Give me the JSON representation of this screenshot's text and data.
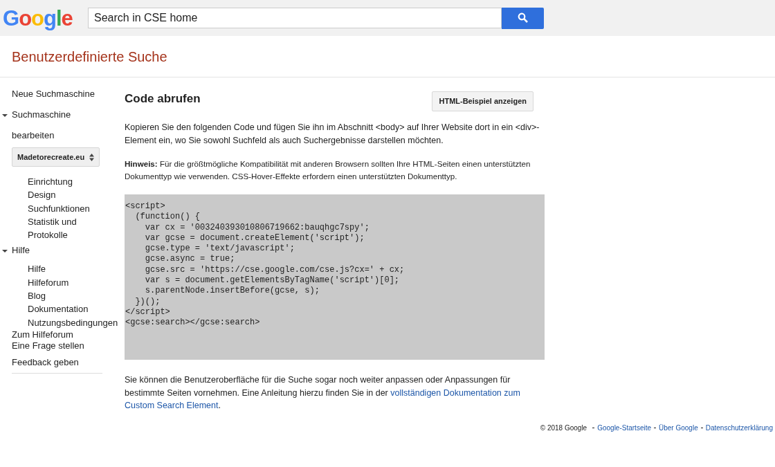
{
  "header": {
    "logo": "Google",
    "search": {
      "placeholder": "Search in CSE home"
    }
  },
  "page_title": "Benutzerdefinierte Suche",
  "sidebar": {
    "items": [
      {
        "kind": "link",
        "label": "Neue Suchmaschine"
      },
      {
        "kind": "section",
        "label": "Suchmaschine bearbeiten",
        "expanded": true,
        "select": "Madetorecreate.eu",
        "children": [
          {
            "label": "Einrichtung"
          },
          {
            "label": "Design"
          },
          {
            "label": "Suchfunktionen"
          },
          {
            "label": "Statistik und Protokolle"
          }
        ]
      },
      {
        "kind": "section",
        "label": "Hilfe",
        "expanded": true,
        "children": [
          {
            "label": "Hilfe"
          },
          {
            "label": "Hilfeforum"
          },
          {
            "label": "Blog"
          },
          {
            "label": "Dokumentation"
          },
          {
            "label": "Nutzungsbedingungen"
          }
        ]
      },
      {
        "kind": "link",
        "label": "Zum Hilfeforum"
      },
      {
        "kind": "link",
        "label": "Eine Frage stellen"
      },
      {
        "kind": "link",
        "label": "Feedback geben"
      }
    ]
  },
  "main": {
    "heading": "Code abrufen",
    "button": "HTML-Beispiel anzeigen",
    "intro": "Kopieren Sie den folgenden Code und fügen Sie ihn im Abschnitt <body> auf Ihrer Website dort in ein <div>-Element ein, wo Sie sowohl Suchfeld als auch Suchergebnisse darstellen möchten.",
    "note": "**Hinweis:** Für die größtmögliche Kompatibilität mit anderen Browsern sollten Ihre HTML-Seiten einen unterstützten Dokumenttyp wie verwenden. CSS-Hover-Effekte erfordern einen unterstützten Dokumenttyp.",
    "code": "<script>\n  (function() {\n    var cx = '003240393010806719662:bauqhgc7spy';\n    var gcse = document.createElement('script');\n    gcse.type = 'text/javascript';\n    gcse.async = true;\n    gcse.src = 'https://cse.google.com/cse.js?cx=' + cx;\n    var s = document.getElementsByTagName('script')[0];\n    s.parentNode.insertBefore(gcse, s);\n  })();\n</script>\n<gcse:search></gcse:search>",
    "outro": "Sie können die Benutzeroberfläche für die Suche sogar noch weiter anpassen oder Anpassungen für bestimmte Seiten vornehmen. Eine Anleitung hierzu finden Sie in der ",
    "outro_link": [
      "vollständigen Dokumentation zum",
      "Custom Search Element"
    ],
    "outro_end": "."
  },
  "footer": {
    "copyright": "© 2018 Google",
    "links": [
      "Google-Startseite",
      "Über Google",
      "Datenschutzerklärung"
    ]
  }
}
